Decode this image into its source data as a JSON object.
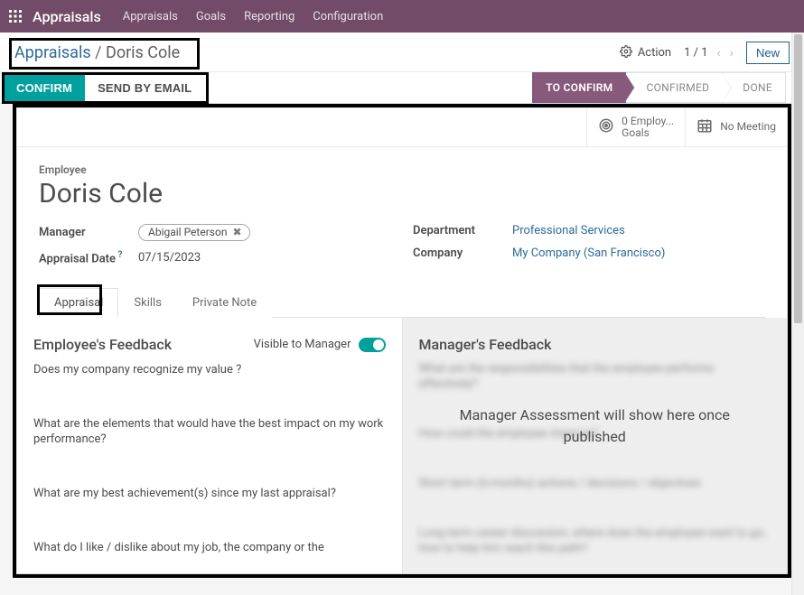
{
  "topbar": {
    "app_title": "Appraisals",
    "nav": [
      "Appraisals",
      "Goals",
      "Reporting",
      "Configuration"
    ]
  },
  "breadcrumb": {
    "root": "Appraisals",
    "current": "Doris Cole"
  },
  "controls": {
    "action_label": "Action",
    "pager": "1 / 1",
    "new_label": "New"
  },
  "action_buttons": {
    "confirm": "CONFIRM",
    "send_email": "SEND BY EMAIL"
  },
  "status_steps": [
    "TO CONFIRM",
    "CONFIRMED",
    "DONE"
  ],
  "stat_buttons": {
    "goals_value": "0 Employ...",
    "goals_label": "Goals",
    "meeting": "No Meeting"
  },
  "record": {
    "employee_label": "Employee",
    "employee_name": "Doris Cole",
    "manager_label": "Manager",
    "manager_value": "Abigail Peterson",
    "appraisal_date_label": "Appraisal Date",
    "appraisal_date_value": "07/15/2023",
    "department_label": "Department",
    "department_value": "Professional Services",
    "company_label": "Company",
    "company_value": "My Company (San Francisco)"
  },
  "tabs": [
    "Appraisal",
    "Skills",
    "Private Note"
  ],
  "feedback": {
    "employee_title": "Employee's Feedback",
    "visible_label": "Visible to Manager",
    "manager_title": "Manager's Feedback",
    "manager_placeholder": "Manager Assessment will show here once published",
    "employee_questions": [
      "Does my company recognize my value ?",
      "What are the elements that would have the best impact on my work performance?",
      "What are my best achievement(s) since my last appraisal?",
      "What do I like / dislike about my job, the company or the"
    ],
    "manager_blurred": [
      "What are the responsibilities that the employee performs effectively?",
      "How could the employee improve?",
      "Short term (6-months) actions / decisions / objectives",
      "Long term career discussion, where does the employee want to go, how to help him reach this path?"
    ]
  }
}
